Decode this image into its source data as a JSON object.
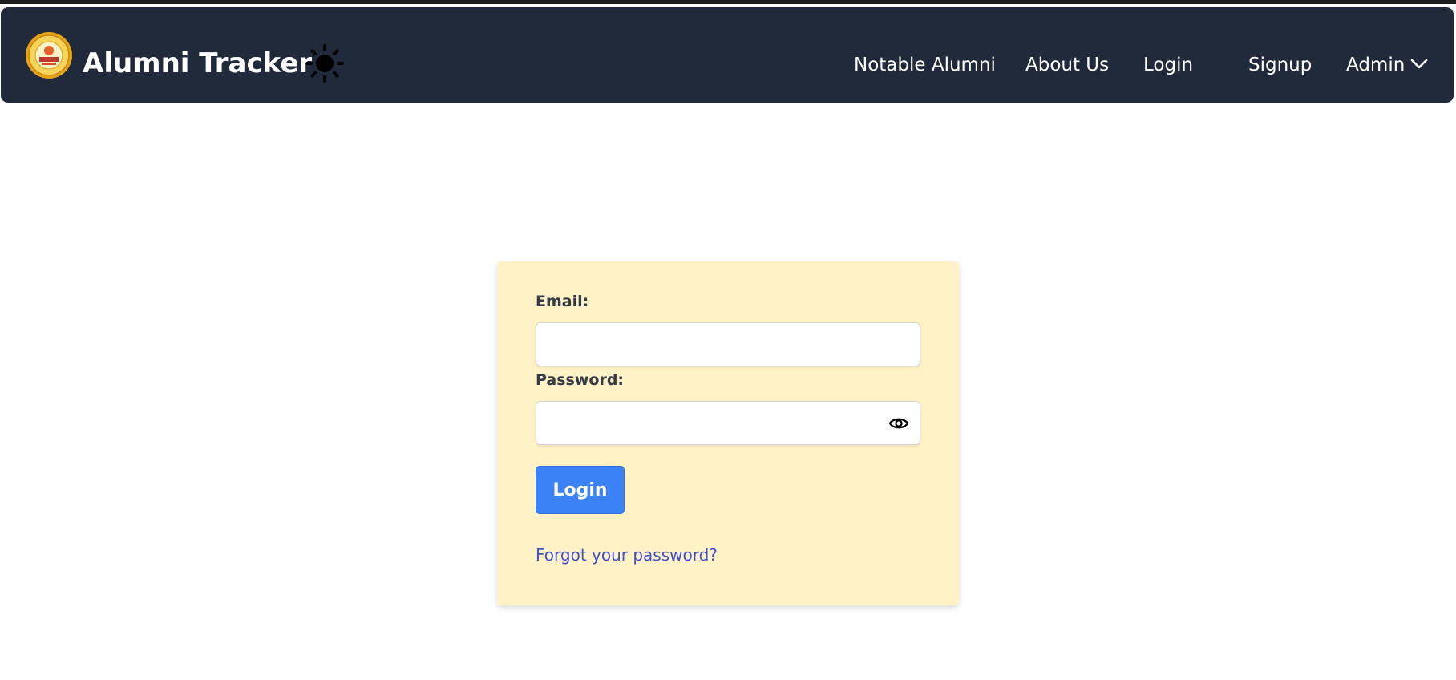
{
  "navbar": {
    "brand": "Alumni Tracker",
    "logo_icon": "college-seal-logo",
    "theme_toggle_icon": "sun-icon",
    "links": {
      "notable_alumni": "Notable Alumni",
      "about_us": "About Us",
      "login": "Login",
      "signup": "Signup",
      "admin": "Admin"
    },
    "admin_dropdown_icon": "chevron-down-icon"
  },
  "login_form": {
    "email_label": "Email:",
    "email_value": "",
    "password_label": "Password:",
    "password_value": "",
    "password_toggle_icon": "eye-icon",
    "submit_label": "Login",
    "forgot_password_link": "Forgot your password?"
  },
  "colors": {
    "navbar_background": "#212a3b",
    "card_background": "#fef2c6",
    "primary_button": "#3b82f6",
    "link": "#3f4fd0"
  }
}
